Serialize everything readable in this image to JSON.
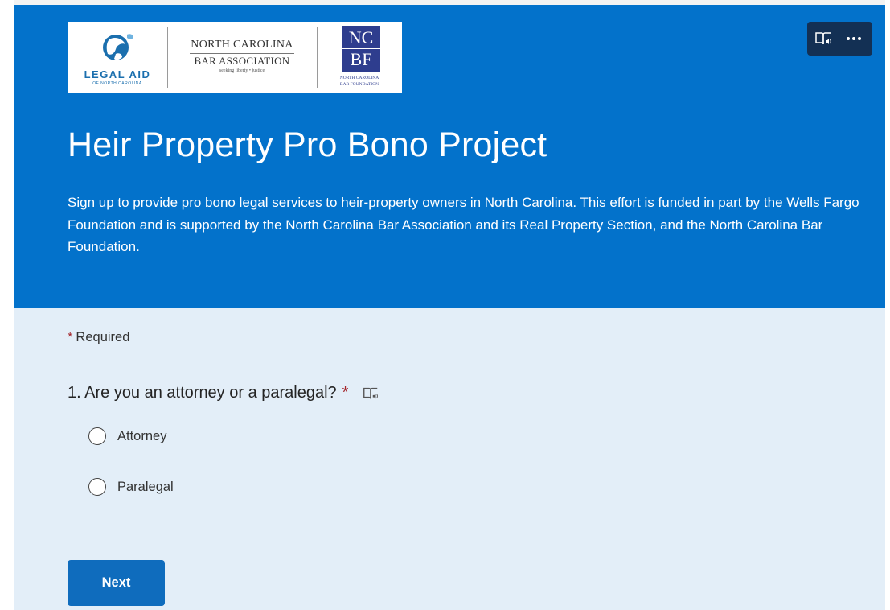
{
  "header": {
    "logos": {
      "legal_aid": {
        "title": "LEGAL AID",
        "subtitle": "OF NORTH CAROLINA"
      },
      "ncba": {
        "line1": "NORTH CAROLINA",
        "line2": "BAR ASSOCIATION",
        "tagline": "seeking liberty • justice"
      },
      "ncbf": {
        "mark_top": "NC",
        "mark_bottom": "BF",
        "caption_line1": "NORTH CAROLINA",
        "caption_line2": "BAR FOUNDATION"
      }
    },
    "toolbar": {
      "immersive_reader_icon": "immersive-reader-icon",
      "more_label": "···"
    },
    "title": "Heir Property Pro Bono Project",
    "description": "Sign up to provide pro bono legal services to heir-property owners in North Carolina. This effort is funded in part by the Wells Fargo Foundation and is supported by the North Carolina Bar Association and its Real Property Section, and the North Carolina Bar Foundation."
  },
  "form": {
    "required_star": "*",
    "required_label": "Required",
    "question": {
      "text": "1. Are you an attorney or a paralegal?",
      "required_star": "*",
      "options": [
        {
          "label": "Attorney",
          "selected": false
        },
        {
          "label": "Paralegal",
          "selected": false
        }
      ]
    },
    "next_label": "Next"
  },
  "colors": {
    "banner": "#0372cb",
    "form_background": "#e3eef8",
    "button": "#0f6cbd",
    "required": "#a4262c",
    "toolbar": "#133054"
  }
}
